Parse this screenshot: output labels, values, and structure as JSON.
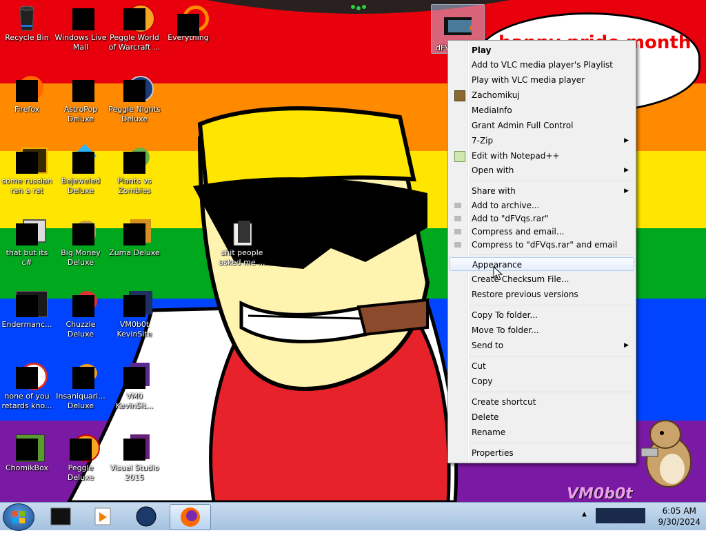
{
  "desktop": {
    "icons": [
      {
        "label": "Recycle Bin"
      },
      {
        "label": "Windows Live Mail"
      },
      {
        "label": "Peggle World of Warcraft ..."
      },
      {
        "label": "Everything"
      },
      {
        "label": "Firefox"
      },
      {
        "label": "AstroPop Deluxe"
      },
      {
        "label": "Peggle Nights Deluxe"
      },
      {
        "label": "some russian ran a rat"
      },
      {
        "label": "Bejeweled Deluxe"
      },
      {
        "label": "Plants vs Zombies"
      },
      {
        "label": "that but its c#"
      },
      {
        "label": "Big Money Deluxe"
      },
      {
        "label": "Zuma Deluxe"
      },
      {
        "label": "Endermanc..."
      },
      {
        "label": "Chuzzle Deluxe"
      },
      {
        "label": "VM0b0t KevinSite"
      },
      {
        "label": "none of you retards kno..."
      },
      {
        "label": "Insaniquari... Deluxe"
      },
      {
        "label": "VM0 KevinSit..."
      },
      {
        "label": "ChomikBox"
      },
      {
        "label": "Peggle Deluxe"
      },
      {
        "label": "Visual Studio 2015"
      },
      {
        "label": "shit people asked me ..."
      },
      {
        "label": "dFV"
      }
    ],
    "speech_bubble": "happy pride month",
    "watermark": "VM0b0t"
  },
  "context_menu": {
    "items": [
      {
        "label": "Play",
        "bold": true
      },
      {
        "label": "Add to VLC media player's Playlist"
      },
      {
        "label": "Play with VLC media player"
      },
      {
        "label": "Zachomikuj"
      },
      {
        "label": "MediaInfo"
      },
      {
        "label": "Grant Admin Full Control"
      },
      {
        "label": "7-Zip"
      },
      {
        "label": "Edit with Notepad++"
      },
      {
        "label": "Open with"
      },
      {
        "label": "Share with"
      },
      {
        "label": "Add to archive..."
      },
      {
        "label": "Add to \"dFVqs.rar\""
      },
      {
        "label": "Compress and email..."
      },
      {
        "label": "Compress to \"dFVqs.rar\" and email"
      },
      {
        "label": "Appearance"
      },
      {
        "label": "Create Checksum File..."
      },
      {
        "label": "Restore previous versions"
      },
      {
        "label": "Copy To folder..."
      },
      {
        "label": "Move To folder..."
      },
      {
        "label": "Send to"
      },
      {
        "label": "Cut"
      },
      {
        "label": "Copy"
      },
      {
        "label": "Create shortcut"
      },
      {
        "label": "Delete"
      },
      {
        "label": "Rename"
      },
      {
        "label": "Properties"
      }
    ],
    "highlighted": "Appearance",
    "submenu_arrow": "▶"
  },
  "taskbar": {
    "clock_time": "6:05 AM",
    "clock_date": "9/30/2024"
  },
  "colors": {
    "red": "#e8000c",
    "orange": "#ff8a00",
    "yellow": "#ffe600",
    "green": "#00a81e",
    "blue": "#0044ff",
    "purple": "#7a1aa4"
  }
}
